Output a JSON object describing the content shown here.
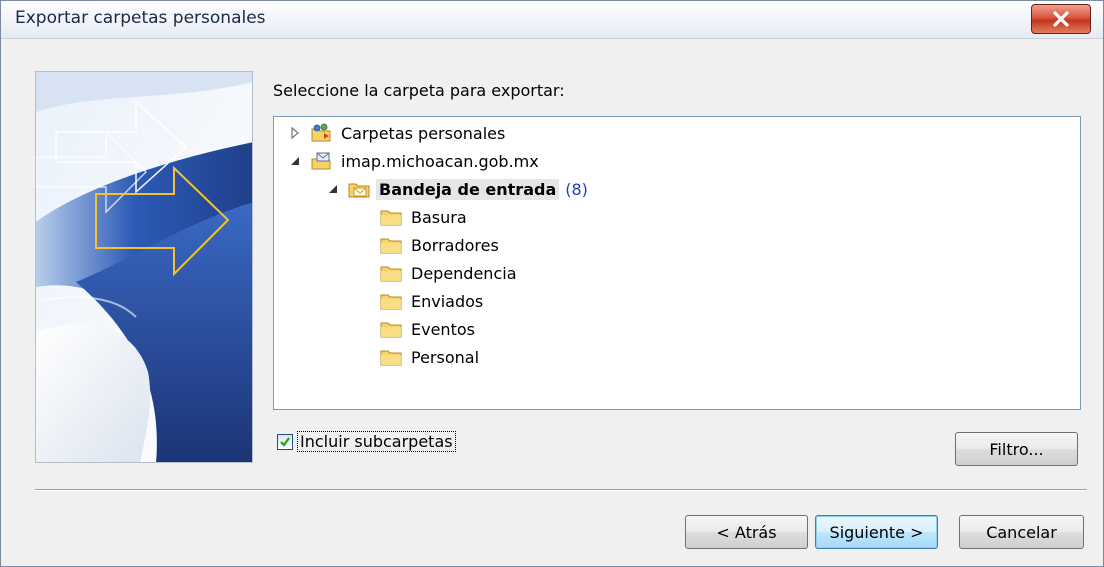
{
  "window": {
    "title": "Exportar carpetas personales"
  },
  "prompt": {
    "text": "Seleccione la carpeta para exportar:"
  },
  "tree": {
    "items": [
      {
        "label": "Carpetas personales",
        "expander": "collapsed",
        "icon": "personal-folders-icon",
        "level": 0
      },
      {
        "label": "imap.michoacan.gob.mx",
        "expander": "expanded",
        "icon": "mail-server-icon",
        "level": 0
      },
      {
        "label": "Bandeja de entrada",
        "count": "(8)",
        "expander": "expanded",
        "icon": "inbox-folder-icon",
        "level": 1,
        "selected": true
      },
      {
        "label": "Basura",
        "icon": "folder-icon",
        "level": 2
      },
      {
        "label": "Borradores",
        "icon": "folder-icon",
        "level": 2
      },
      {
        "label": "Dependencia",
        "icon": "folder-icon",
        "level": 2
      },
      {
        "label": "Enviados",
        "icon": "folder-icon",
        "level": 2
      },
      {
        "label": "Eventos",
        "icon": "folder-icon",
        "level": 2
      },
      {
        "label": "Personal",
        "icon": "folder-icon",
        "level": 2
      }
    ]
  },
  "options": {
    "include_subfolders_label": "Incluir subcarpetas",
    "include_subfolders_checked": true
  },
  "buttons": {
    "filter": "Filtro...",
    "back": "< Atrás",
    "next": "Siguiente >",
    "cancel": "Cancelar"
  },
  "colors": {
    "accent_blue": "#1d3fbf",
    "folder_yellow": "#f5d36a",
    "close_red": "#c2361f"
  }
}
